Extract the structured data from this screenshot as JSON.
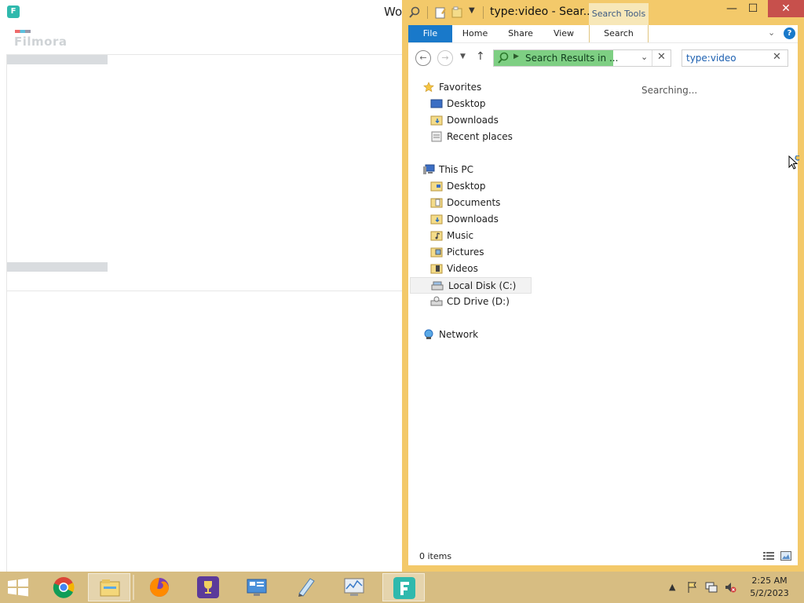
{
  "filmora": {
    "app_icon_letter": "F",
    "title": "Wo",
    "logo": "Filmora"
  },
  "explorer": {
    "title": "type:video - Sear...",
    "context_tab": "Search Tools",
    "window_controls": {
      "minimize": "—",
      "maximize": "☐",
      "close": "✕"
    },
    "ribbon": {
      "file": "File",
      "home": "Home",
      "share": "Share",
      "view": "View",
      "search": "Search",
      "help": "?"
    },
    "address": {
      "text": "Search Results in ...",
      "dropdown": "⌄",
      "clear": "✕"
    },
    "search": {
      "value": "type:video",
      "clear": "✕"
    },
    "nav": {
      "favorites": {
        "label": "Favorites",
        "items": [
          "Desktop",
          "Downloads",
          "Recent places"
        ]
      },
      "this_pc": {
        "label": "This PC",
        "items": [
          "Desktop",
          "Documents",
          "Downloads",
          "Music",
          "Pictures",
          "Videos",
          "Local Disk (C:)",
          "CD Drive (D:)"
        ]
      },
      "network": {
        "label": "Network"
      }
    },
    "searching_text": "Searching...",
    "status": "0 items"
  },
  "taskbar": {
    "time": "2:25 AM",
    "date": "5/2/2023"
  },
  "colors": {
    "explorer_frame": "#f3c96a",
    "taskbar": "#d7bd82",
    "file_tab": "#1979ca",
    "address_highlight": "#7ecf83",
    "close_button": "#c7504c"
  }
}
